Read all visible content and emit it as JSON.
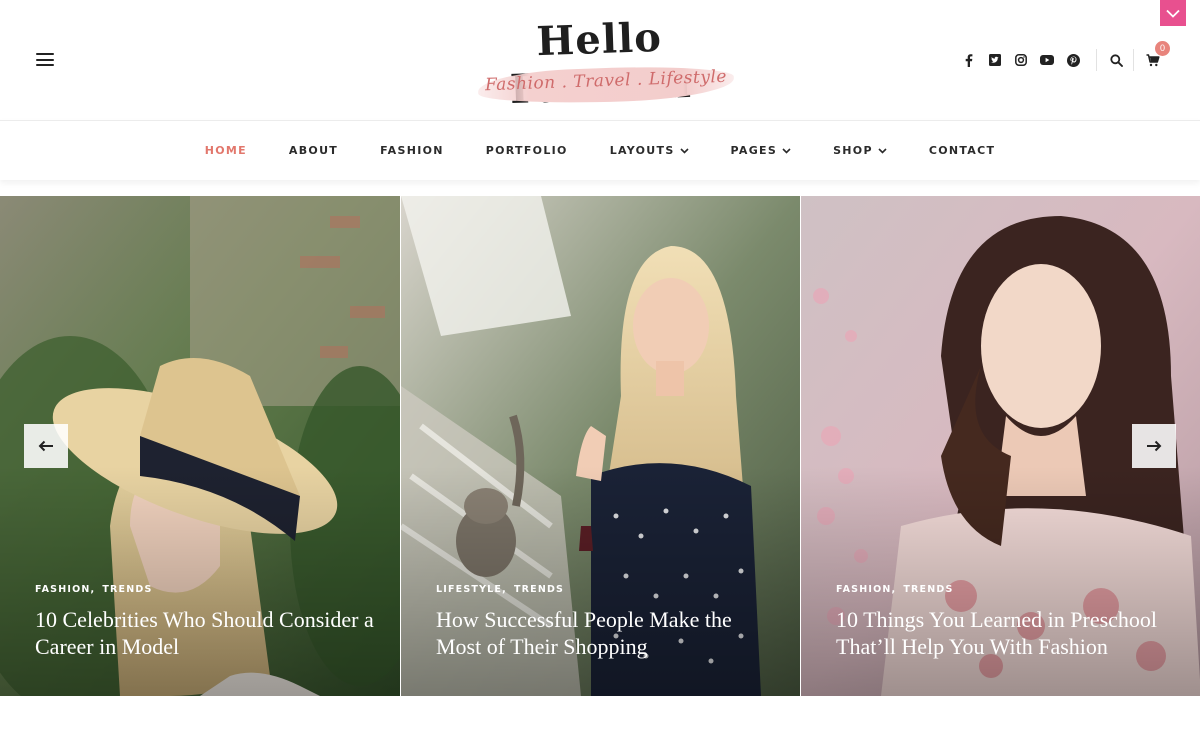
{
  "header": {
    "logo_title": "Hello Fashion",
    "logo_tagline": "Fashion . Travel . Lifestyle",
    "cart_count": "0",
    "accent_color": "#e2776c",
    "toggle_color": "#e8508f",
    "social_icons": [
      "facebook-icon",
      "twitter-icon",
      "instagram-icon",
      "youtube-icon",
      "pinterest-icon"
    ]
  },
  "nav": {
    "items": [
      {
        "label": "HOME",
        "active": true,
        "dropdown": false
      },
      {
        "label": "ABOUT",
        "active": false,
        "dropdown": false
      },
      {
        "label": "FASHION",
        "active": false,
        "dropdown": false
      },
      {
        "label": "PORTFOLIO",
        "active": false,
        "dropdown": false
      },
      {
        "label": "LAYOUTS",
        "active": false,
        "dropdown": true
      },
      {
        "label": "PAGES",
        "active": false,
        "dropdown": true
      },
      {
        "label": "SHOP",
        "active": false,
        "dropdown": true
      },
      {
        "label": "CONTACT",
        "active": false,
        "dropdown": false
      }
    ]
  },
  "slider": {
    "slides": [
      {
        "cat1": "FASHION",
        "cat2": "TRENDS",
        "title": "10 Celebrities Who Should Consider a Career in Model"
      },
      {
        "cat1": "LIFESTYLE",
        "cat2": "TRENDS",
        "title": "How Successful People Make the Most of Their Shopping"
      },
      {
        "cat1": "FASHION",
        "cat2": "TRENDS",
        "title": "10 Things You Learned in Preschool That’ll Help You With Fashion"
      }
    ]
  }
}
